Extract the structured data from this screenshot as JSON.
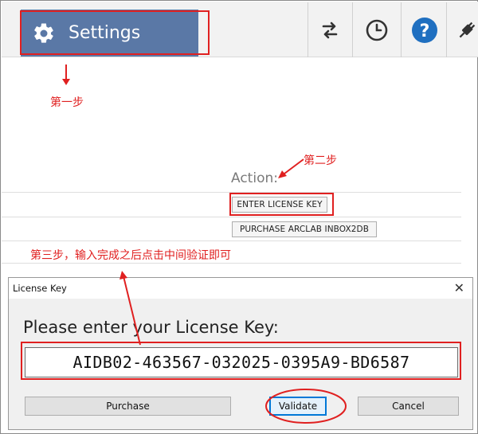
{
  "toolbar": {
    "settings_label": "Settings"
  },
  "content": {
    "action_label": "Action:",
    "enter_license_key_label": "ENTER LICENSE KEY",
    "purchase_arclab_label": "PURCHASE ARCLAB INBOX2DB"
  },
  "annotations": {
    "step1": "第一步",
    "step2": "第二步",
    "step3": "第三步，输入完成之后点击中间验证即可"
  },
  "dialog": {
    "title": "License Key",
    "close_glyph": "✕",
    "prompt": "Please enter your License Key:",
    "license_key_value": "AIDB02-463567-032025-0395A9-BD6587",
    "purchase_label": "Purchase",
    "validate_label": "Validate",
    "cancel_label": "Cancel"
  },
  "colors": {
    "settings_bg": "#5a78a6",
    "annotation_red": "#e02020",
    "help_blue": "#1f6fc0"
  },
  "icons": [
    "gear-icon",
    "swap-arrows-icon",
    "clock-icon",
    "help-icon",
    "plug-icon",
    "close-icon"
  ]
}
